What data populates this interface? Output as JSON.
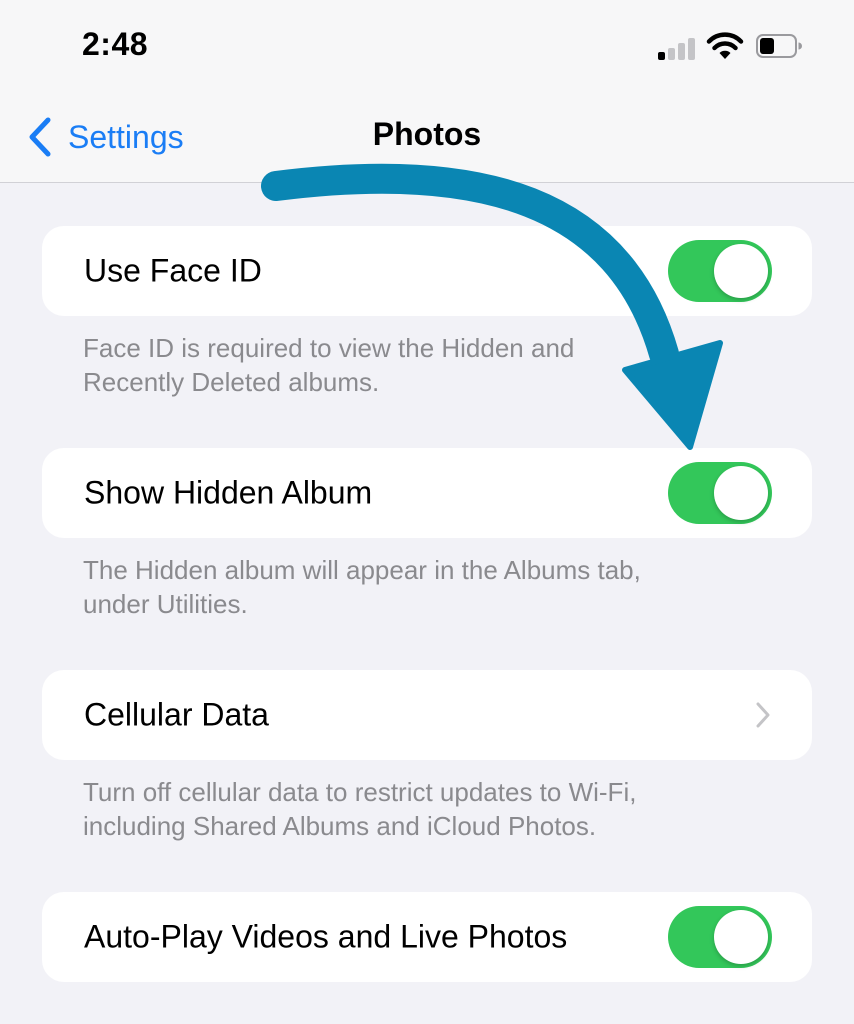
{
  "status_bar": {
    "time": "2:48",
    "icons": [
      "cellular-signal-icon",
      "wifi-icon",
      "battery-icon"
    ]
  },
  "nav": {
    "back_label": "Settings",
    "title": "Photos"
  },
  "settings": [
    {
      "label": "Use Face ID",
      "control": "toggle",
      "state": "on",
      "footer_lines": [
        "Face ID is required to view the Hidden and",
        "Recently Deleted albums."
      ]
    },
    {
      "label": "Show Hidden Album",
      "control": "toggle",
      "state": "on",
      "footer_lines": [
        "The Hidden album will appear in the Albums tab,",
        "under Utilities."
      ]
    },
    {
      "label": "Cellular Data",
      "control": "disclosure",
      "footer_lines": [
        "Turn off cellular data to restrict updates to Wi-Fi,",
        "including Shared Albums and iCloud Photos."
      ]
    },
    {
      "label": "Auto-Play Videos and Live Photos",
      "control": "toggle",
      "state": "on"
    }
  ],
  "colors": {
    "accent_blue": "#1a7df5",
    "toggle_on": "#33c75a",
    "annotation_arrow": "#0a86b3",
    "background": "#f2f2f7"
  }
}
